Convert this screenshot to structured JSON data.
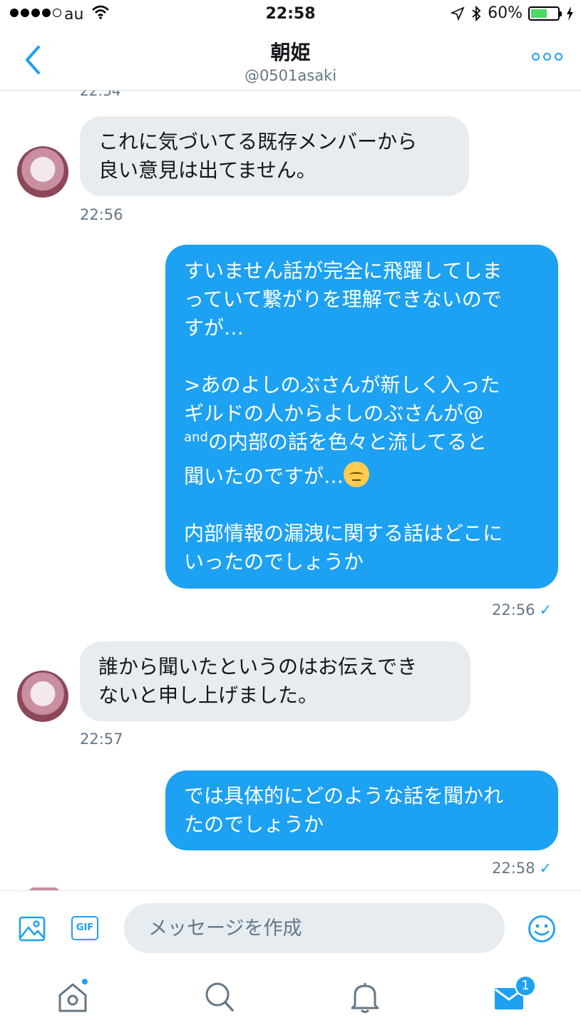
{
  "status_bar": {
    "carrier": "au",
    "time": "22:58",
    "battery_percent": "60%",
    "battery_level": 0.6,
    "signal_bars_filled": 4
  },
  "header": {
    "title": "朝姫",
    "handle": "@0501asaki",
    "back_icon": "chevron-left-icon",
    "more_icon": "more-dots-icon"
  },
  "messages": [
    {
      "direction": "incoming",
      "lines": [
        "これに気づいてる既存メンバーから",
        "良い意見は出てません。"
      ],
      "time": "22:56"
    },
    {
      "direction": "outgoing",
      "lines": [
        "すいません話が完全に飛躍してしま",
        "っていて繋がりを理解できないので",
        "すが…",
        "",
        ">あのよしのぶさんが新しく入った",
        "ギルドの人からよしのぶさんが@",
        "and",
        "の内部の話を色々と流してると",
        "聞いたのですが…",
        "",
        "内部情報の漏洩に関する話はどこに",
        "いったのでしょうか"
      ],
      "time": "22:56",
      "read_check": "✓"
    },
    {
      "direction": "incoming",
      "lines": [
        "誰から聞いたというのはお伝えでき",
        "ないと申し上げました。"
      ],
      "time": "22:57"
    },
    {
      "direction": "outgoing",
      "lines": [
        "では具体的にどのような話を聞かれ",
        "たのでしょうか"
      ],
      "time": "22:58",
      "read_check": "✓"
    }
  ],
  "composer": {
    "placeholder": "メッセージを作成",
    "gif_label": "GIF"
  },
  "tab_bar": {
    "dm_badge": "1"
  },
  "colors": {
    "accent": "#1da1f2",
    "incoming_bubble": "#e6ecf0",
    "muted_text": "#657786",
    "battery": "#4cd964"
  }
}
